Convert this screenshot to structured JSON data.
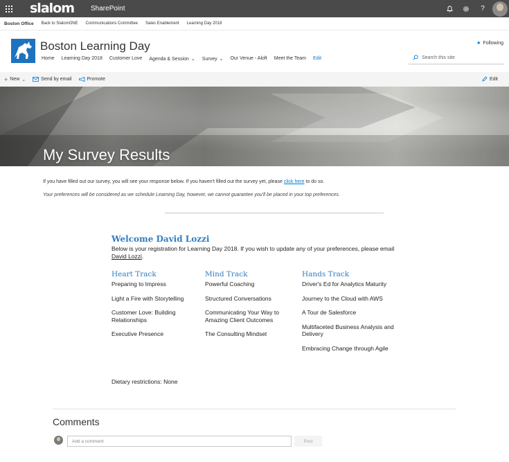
{
  "suite_bar": {
    "brand": "slalom",
    "app": "SharePoint",
    "icons": [
      "waffle-icon",
      "bell-icon",
      "gear-icon",
      "help-icon"
    ],
    "help_label": "?"
  },
  "hub_nav": {
    "items": [
      "Boston Office",
      "Back to SlalomONE",
      "Communications Committee",
      "Sales Enablement",
      "Learning Day 2018"
    ]
  },
  "site": {
    "title": "Boston Learning Day",
    "nav": [
      "Home",
      "Learning Day 2018",
      "Customer Love",
      "Agenda & Session",
      "Survey",
      "Our Venue - Aloft",
      "Meet the Team",
      "Edit"
    ],
    "following": "Following",
    "search_placeholder": "Search this site"
  },
  "command_bar": {
    "new_label": "New",
    "send_label": "Send by email",
    "promote_label": "Promote",
    "edit_label": "Edit"
  },
  "hero": {
    "title": "My Survey Results"
  },
  "intro": {
    "text_before": "If you have filled out our survey, you will see your response below. If you haven't filled out the survey yet, please ",
    "link": "click here",
    "text_after": " to do so.",
    "note": "Your preferences will be considered as we schedule Learning Day, however, we cannot guarantee you'll be placed in your top preferences."
  },
  "results": {
    "welcome": "Welcome David Lozzi",
    "reg_text": "Below is your registration for Learning Day 2018. If you wish to update any of your preferences, please email ",
    "reg_link": "David Lozzi",
    "reg_end": ".",
    "tracks": [
      {
        "name": "Heart Track",
        "items": [
          "Preparing to Impress",
          "Light a Fire with Storytelling",
          "Customer Love: Building Relationships",
          "Executive Presence"
        ]
      },
      {
        "name": "Mind Track",
        "items": [
          "Powerful Coaching",
          "Structured Conversations",
          "Communicating Your Way to Amazing Client Outcomes",
          "The Consulting Mindset"
        ]
      },
      {
        "name": "Hands Track",
        "items": [
          "Driver's Ed for Analytics Maturity",
          "Journey to the Cloud with AWS",
          "A Tour de Salesforce",
          "Multifaceted Business Analysis and Delivery",
          "Embracing Change through Agile"
        ]
      }
    ],
    "dietary": "Dietary restrictions: None"
  },
  "comments": {
    "title": "Comments",
    "placeholder": "Add a comment",
    "post_label": "Post"
  },
  "colors": {
    "suite_bar": "#4a4a4a",
    "accent": "#0078d4",
    "heading_blue": "#2e7dc2"
  }
}
